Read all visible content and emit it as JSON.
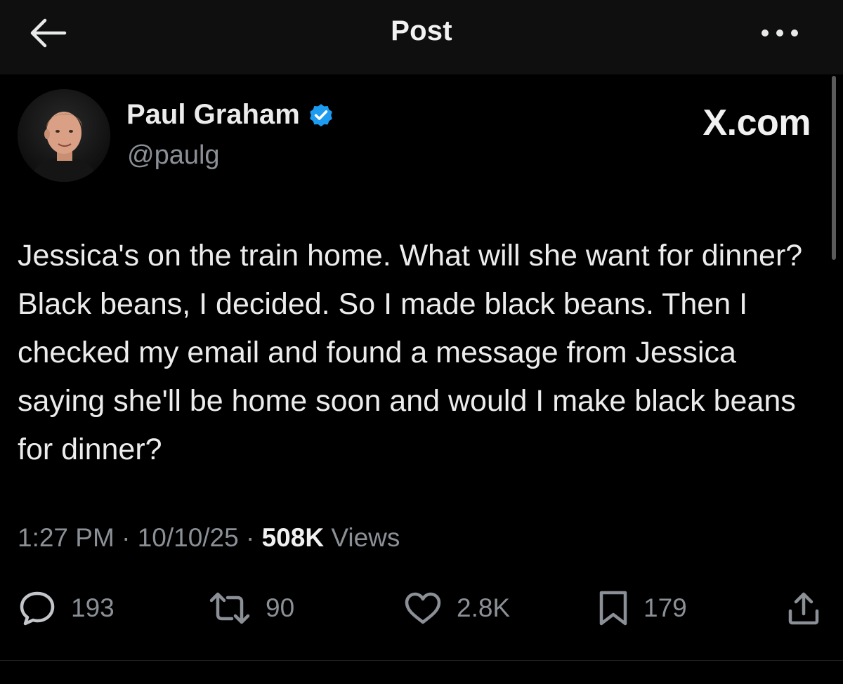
{
  "header": {
    "title": "Post",
    "back_icon": "arrow-left-icon",
    "more_icon": "more-dots-icon"
  },
  "author": {
    "name": "Paul Graham",
    "handle": "@paulg",
    "verified": true,
    "verified_color": "#1d9bf0"
  },
  "brand": {
    "label": "X.com"
  },
  "tweet": {
    "text": "Jessica's on the train home. What will she want for dinner? Black beans, I decided. So I made black beans. Then I checked my email and found a message from Jessica saying she'll be home soon and would I make black beans for dinner?"
  },
  "meta": {
    "time": "1:27 PM",
    "date": "10/10/25",
    "views_count": "508K",
    "views_label": "Views",
    "separator": "·"
  },
  "actions": {
    "reply_count": "193",
    "repost_count": "90",
    "like_count": "2.8K",
    "bookmark_count": "179"
  },
  "colors": {
    "background": "#000000",
    "header_background": "#0f0f0f",
    "primary_text": "#e7e9ea",
    "secondary_text": "#8b9096"
  }
}
